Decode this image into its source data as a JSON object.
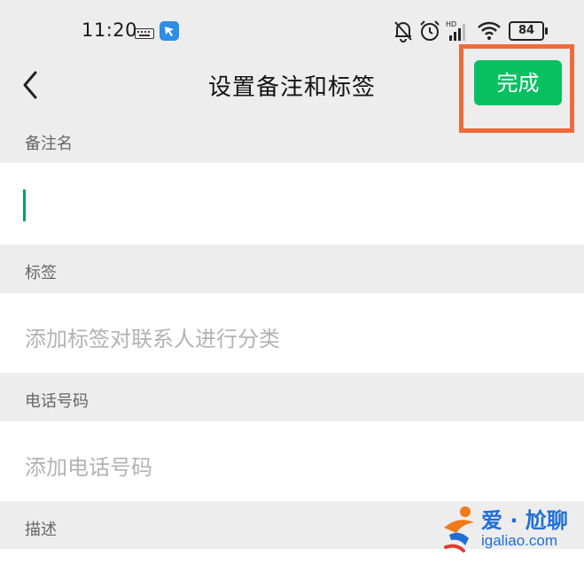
{
  "status_bar": {
    "time": "11:20",
    "battery": "84",
    "icons": [
      "keyboard-icon",
      "app-icon",
      "mute-bell-icon",
      "alarm-icon",
      "signal-icon",
      "wifi-icon",
      "battery-icon"
    ]
  },
  "navbar": {
    "title": "设置备注和标签",
    "done_label": "完成"
  },
  "sections": {
    "remark": {
      "label": "备注名",
      "value": ""
    },
    "tags": {
      "label": "标签",
      "placeholder": "添加标签对联系人进行分类"
    },
    "phone": {
      "label": "电话号码",
      "placeholder": "添加电话号码"
    },
    "description": {
      "label": "描述"
    }
  },
  "watermark": {
    "line1": "爱 · 尬聊",
    "line2": "igaliao.com"
  },
  "colors": {
    "accent": "#07c160",
    "highlight": "#ef6a3a",
    "background": "#ededed"
  }
}
